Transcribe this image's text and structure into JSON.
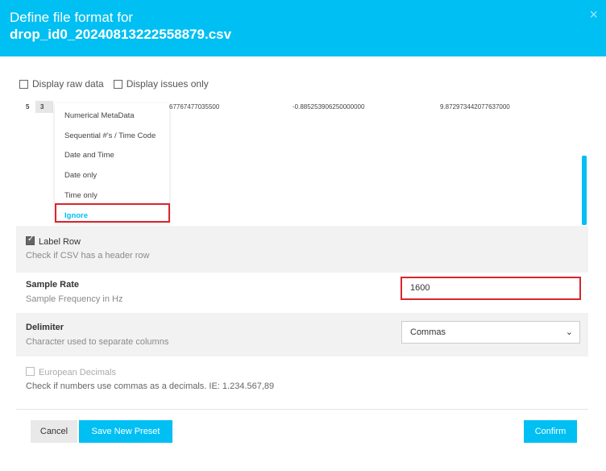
{
  "dialog": {
    "title_line1": "Define file format for",
    "title_line2": "drop_id0_20240813222558879.csv",
    "close_icon": "×"
  },
  "options": {
    "display_raw_data": "Display raw data",
    "display_issues_only": "Display issues only"
  },
  "preview": {
    "row_index": "5",
    "cell_value": "3",
    "col1_value": "67767477035500",
    "col2_value": "-0.885253906250000000",
    "col3_value": "9.872973442077637000"
  },
  "column_type_menu": {
    "items": [
      "Numerical MetaData",
      "Sequential #'s / Time Code",
      "Date and Time",
      "Date only",
      "Time only",
      "Ignore"
    ],
    "selected": "Ignore"
  },
  "label_row": {
    "title": "Label Row",
    "description": "Check if CSV has a header row",
    "checked": true
  },
  "sample_rate": {
    "title": "Sample Rate",
    "description": "Sample Frequency in Hz",
    "value": "1600"
  },
  "delimiter": {
    "title": "Delimiter",
    "description": "Character used to separate columns",
    "value": "Commas"
  },
  "european_decimals": {
    "title": "European Decimals",
    "description": "Check if numbers use commas as a decimals. IE: 1.234.567,89",
    "checked": false
  },
  "buttons": {
    "cancel": "Cancel",
    "save_preset": "Save New Preset",
    "confirm": "Confirm"
  },
  "colors": {
    "accent": "#00bff3",
    "highlight": "#d9252e"
  }
}
